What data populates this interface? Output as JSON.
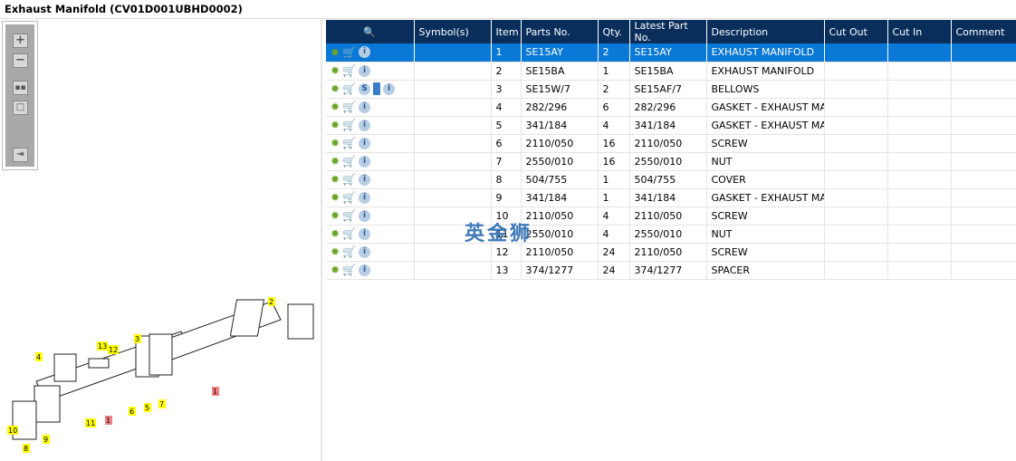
{
  "title": "Exhaust Manifold (CV01D001UBHD0002)",
  "toolbar": {
    "zoom_in": "zoom-in",
    "zoom_out": "zoom-out",
    "fit": "fit-all",
    "actual": "actual-size",
    "export": "export"
  },
  "columns": [
    "",
    "Symbol(s)",
    "Item",
    "Parts No.",
    "Qty.",
    "Latest Part No.",
    "Description",
    "Cut Out",
    "Cut In",
    "Comment"
  ],
  "rows": [
    {
      "item": "1",
      "parts_no": "SE15AY",
      "qty": "2",
      "latest": "SE15AY",
      "desc": "EXHAUST MANIFOLD",
      "selected": true
    },
    {
      "item": "2",
      "parts_no": "SE15BA",
      "qty": "1",
      "latest": "SE15BA",
      "desc": "EXHAUST MANIFOLD"
    },
    {
      "item": "3",
      "parts_no": "SE15W/7",
      "qty": "2",
      "latest": "SE15AF/7",
      "desc": "BELLOWS",
      "extra": true
    },
    {
      "item": "4",
      "parts_no": "282/296",
      "qty": "6",
      "latest": "282/296",
      "desc": "GASKET - EXHAUST MANI"
    },
    {
      "item": "5",
      "parts_no": "341/184",
      "qty": "4",
      "latest": "341/184",
      "desc": "GASKET - EXHAUST MANI"
    },
    {
      "item": "6",
      "parts_no": "2110/050",
      "qty": "16",
      "latest": "2110/050",
      "desc": "SCREW"
    },
    {
      "item": "7",
      "parts_no": "2550/010",
      "qty": "16",
      "latest": "2550/010",
      "desc": "NUT"
    },
    {
      "item": "8",
      "parts_no": "504/755",
      "qty": "1",
      "latest": "504/755",
      "desc": "COVER"
    },
    {
      "item": "9",
      "parts_no": "341/184",
      "qty": "1",
      "latest": "341/184",
      "desc": "GASKET - EXHAUST MANI"
    },
    {
      "item": "10",
      "parts_no": "2110/050",
      "qty": "4",
      "latest": "2110/050",
      "desc": "SCREW"
    },
    {
      "item": "11",
      "parts_no": "2550/010",
      "qty": "4",
      "latest": "2550/010",
      "desc": "NUT"
    },
    {
      "item": "12",
      "parts_no": "2110/050",
      "qty": "24",
      "latest": "2110/050",
      "desc": "SCREW"
    },
    {
      "item": "13",
      "parts_no": "374/1277",
      "qty": "24",
      "latest": "374/1277",
      "desc": "SPACER"
    }
  ],
  "callouts": [
    "1",
    "2",
    "3",
    "4",
    "5",
    "6",
    "7",
    "8",
    "9",
    "10",
    "11",
    "12",
    "13",
    "1"
  ],
  "watermark": "英金狮"
}
